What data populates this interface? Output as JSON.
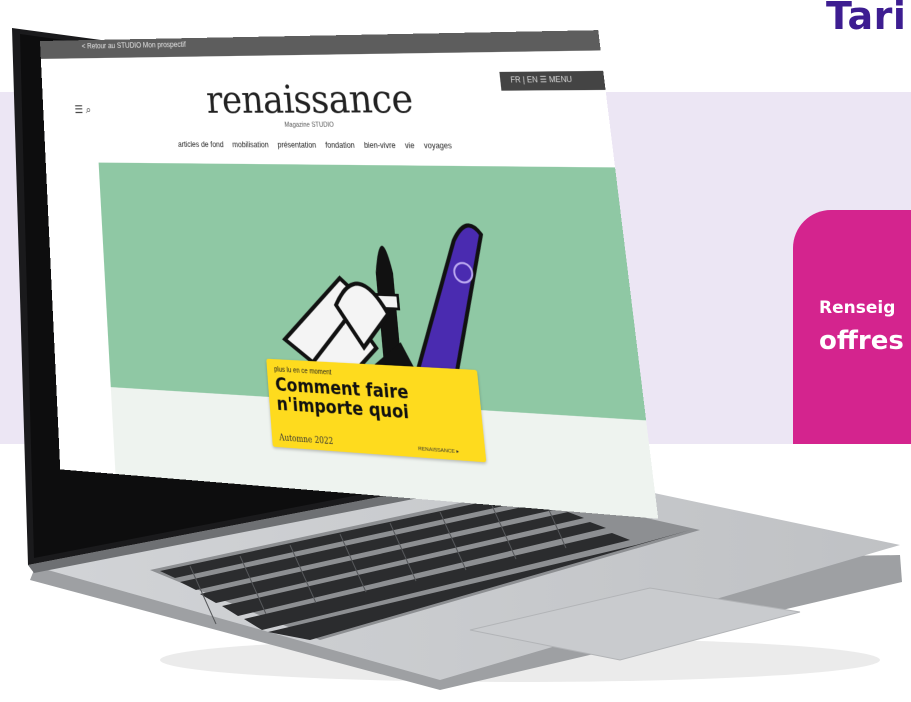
{
  "page": {
    "heading": "Tari",
    "accent_color": "#3d1d91",
    "band_color": "#ece6f4"
  },
  "promo": {
    "line1": "Renseig",
    "line2": "offres",
    "color": "#d4248e"
  },
  "screen": {
    "topbar_text": "< Retour au STUDIO Mon prospectif",
    "logo": "renaissance",
    "logo_sub": "Magazine STUDIO",
    "lang": "FR | EN   ☰ MENU",
    "nav": [
      "articles de fond",
      "mobilisation",
      "présentation",
      "fondation",
      "bien-vivre",
      "vie",
      "voyages"
    ],
    "hero_color": "#8fc8a4",
    "card": {
      "kicker": "plus lu en ce moment",
      "title": "Comment faire n'importe quoi",
      "date": "Automne 2022",
      "foot": "RENAISSANCE ▸",
      "color": "#fedb1e"
    }
  }
}
